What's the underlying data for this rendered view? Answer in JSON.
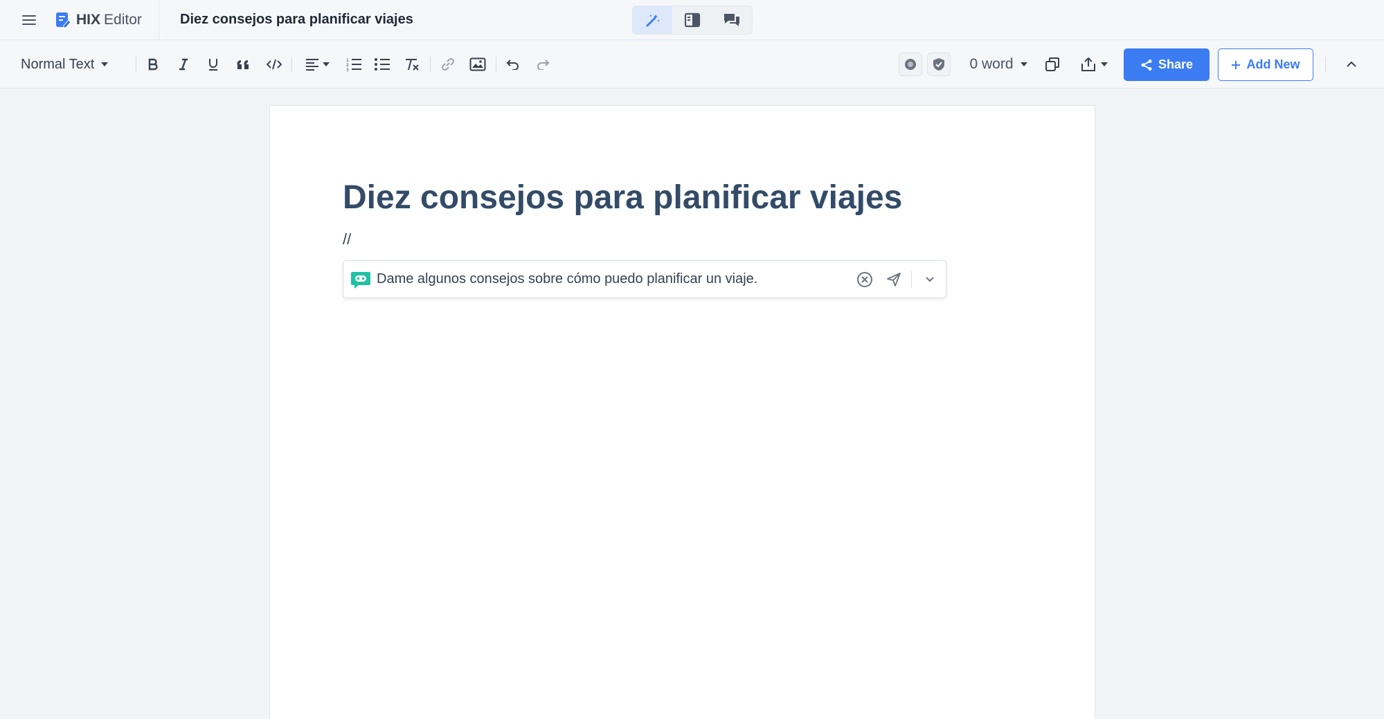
{
  "topbar": {
    "brand_name": "HIX",
    "brand_sub": "Editor",
    "doc_title": "Diez consejos para planificar viajes",
    "views": [
      "magic-wand-icon",
      "split-panel-icon",
      "chat-icon"
    ]
  },
  "toolbar": {
    "text_style": "Normal Text",
    "word_count": "0 word",
    "share_label": "Share",
    "add_new_label": "Add New"
  },
  "document": {
    "heading": "Diez consejos para planificar viajes",
    "command_marker": "//",
    "prompt_value": "Dame algunos consejos sobre cómo puedo planificar un viaje."
  },
  "colors": {
    "accent": "#3b7cf3",
    "heading": "#334b68",
    "bot": "#1fc2a4"
  }
}
